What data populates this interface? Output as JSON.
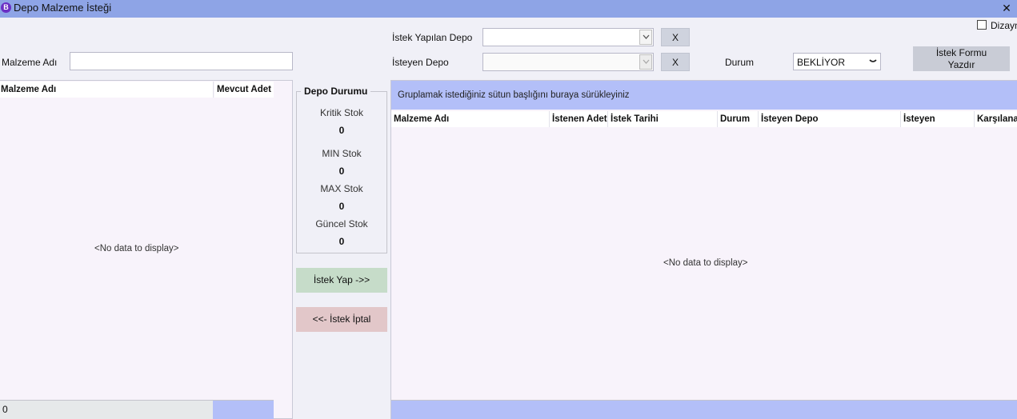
{
  "window": {
    "title": "Depo Malzeme İsteği",
    "close_label": "✕"
  },
  "form": {
    "malzeme_adi_label": "Malzeme Adı",
    "malzeme_adi_value": "",
    "istek_yapilan_depo_label": "İstek Yapılan Depo",
    "istek_yapilan_depo_value": "",
    "isteyen_depo_label": "İsteyen Depo",
    "isteyen_depo_value": "",
    "clear_label": "X",
    "durum_label": "Durum",
    "durum_value": "BEKLİYOR",
    "print_button_line1": "İstek Formu",
    "print_button_line2": "Yazdır",
    "design_checkbox_label": "Dizayn",
    "design_checked": false
  },
  "left_grid": {
    "columns": [
      "Malzeme Adı",
      "Mevcut Adet"
    ],
    "empty_text": "<No data to display>",
    "footer_count": "0"
  },
  "depo_durumu": {
    "title": "Depo Durumu",
    "items": [
      {
        "label": "Kritik Stok",
        "value": "0"
      },
      {
        "label": "MIN Stok",
        "value": "0"
      },
      {
        "label": "MAX Stok",
        "value": "0"
      },
      {
        "label": "Güncel Stok",
        "value": "0"
      }
    ]
  },
  "actions": {
    "istek_yap": "İstek Yap ->>",
    "istek_iptal": "<<- İstek İptal"
  },
  "right_grid": {
    "group_panel_text": "Gruplamak istediğiniz sütun başlığını buraya sürükleyiniz",
    "columns": [
      "Malzeme Adı",
      "İstenen Adet",
      "İstek Tarihi",
      "Durum",
      "İsteyen Depo",
      "İsteyen",
      "Karşılanan"
    ],
    "empty_text": "<No data to display>"
  },
  "colors": {
    "title_bar": "#8ea4e6",
    "accent_panel": "#b3bff8",
    "request_button": "#c6dcc9",
    "cancel_button": "#e2c7c9"
  }
}
